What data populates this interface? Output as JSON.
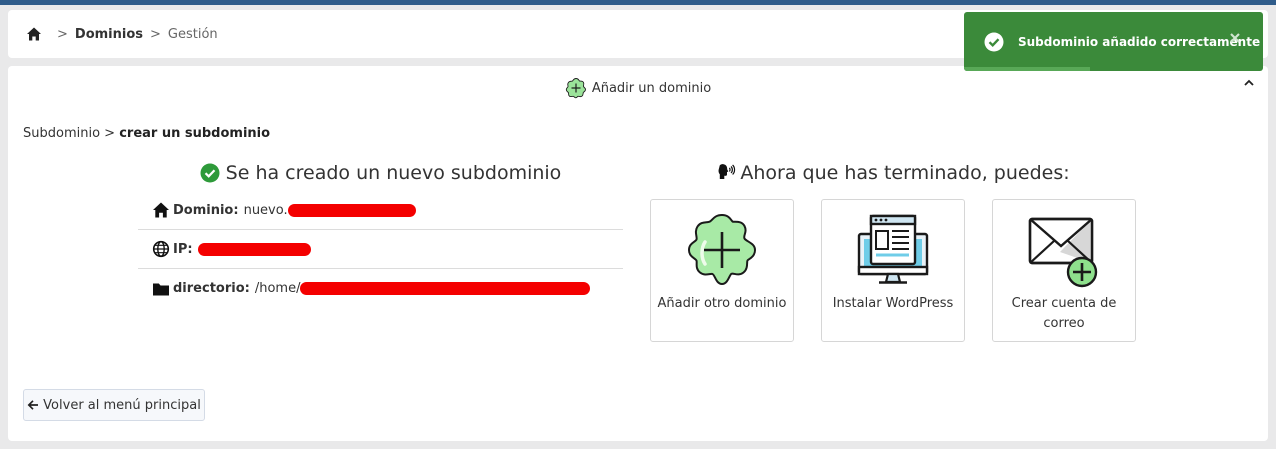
{
  "breadcrumb": {
    "home_icon": "home-icon",
    "section": "Dominios",
    "page": "Gestión"
  },
  "add_domain": {
    "label": "Añadir un dominio",
    "icon": "add-flower-icon"
  },
  "sub_breadcrumb": {
    "parent": "Subdominio",
    "current": "crear un subdominio"
  },
  "result": {
    "title": "Se ha creado un nuevo subdominio",
    "rows": [
      {
        "label": "Dominio:",
        "value": "nuevo.",
        "icon": "home-icon"
      },
      {
        "label": "IP:",
        "value": "",
        "icon": "globe-icon"
      },
      {
        "label": "directorio:",
        "value": "/home/",
        "icon": "folder-icon"
      }
    ]
  },
  "next_steps": {
    "title": "Ahora que has terminado, puedes:",
    "actions": [
      {
        "label": "Añadir otro dominio",
        "icon": "add-domain-icon"
      },
      {
        "label": "Instalar WordPress",
        "icon": "monitor-browser-icon"
      },
      {
        "label": "Crear cuenta de correo",
        "icon": "mail-add-icon"
      }
    ]
  },
  "back_button": {
    "label": "Volver al menú principal"
  },
  "toast": {
    "message": "Subdominio añadido correctamente",
    "progress": 0.42
  },
  "colors": {
    "toast_bg": "#3b8a3a",
    "redaction": "#f40000",
    "success": "#2e9a3a"
  }
}
